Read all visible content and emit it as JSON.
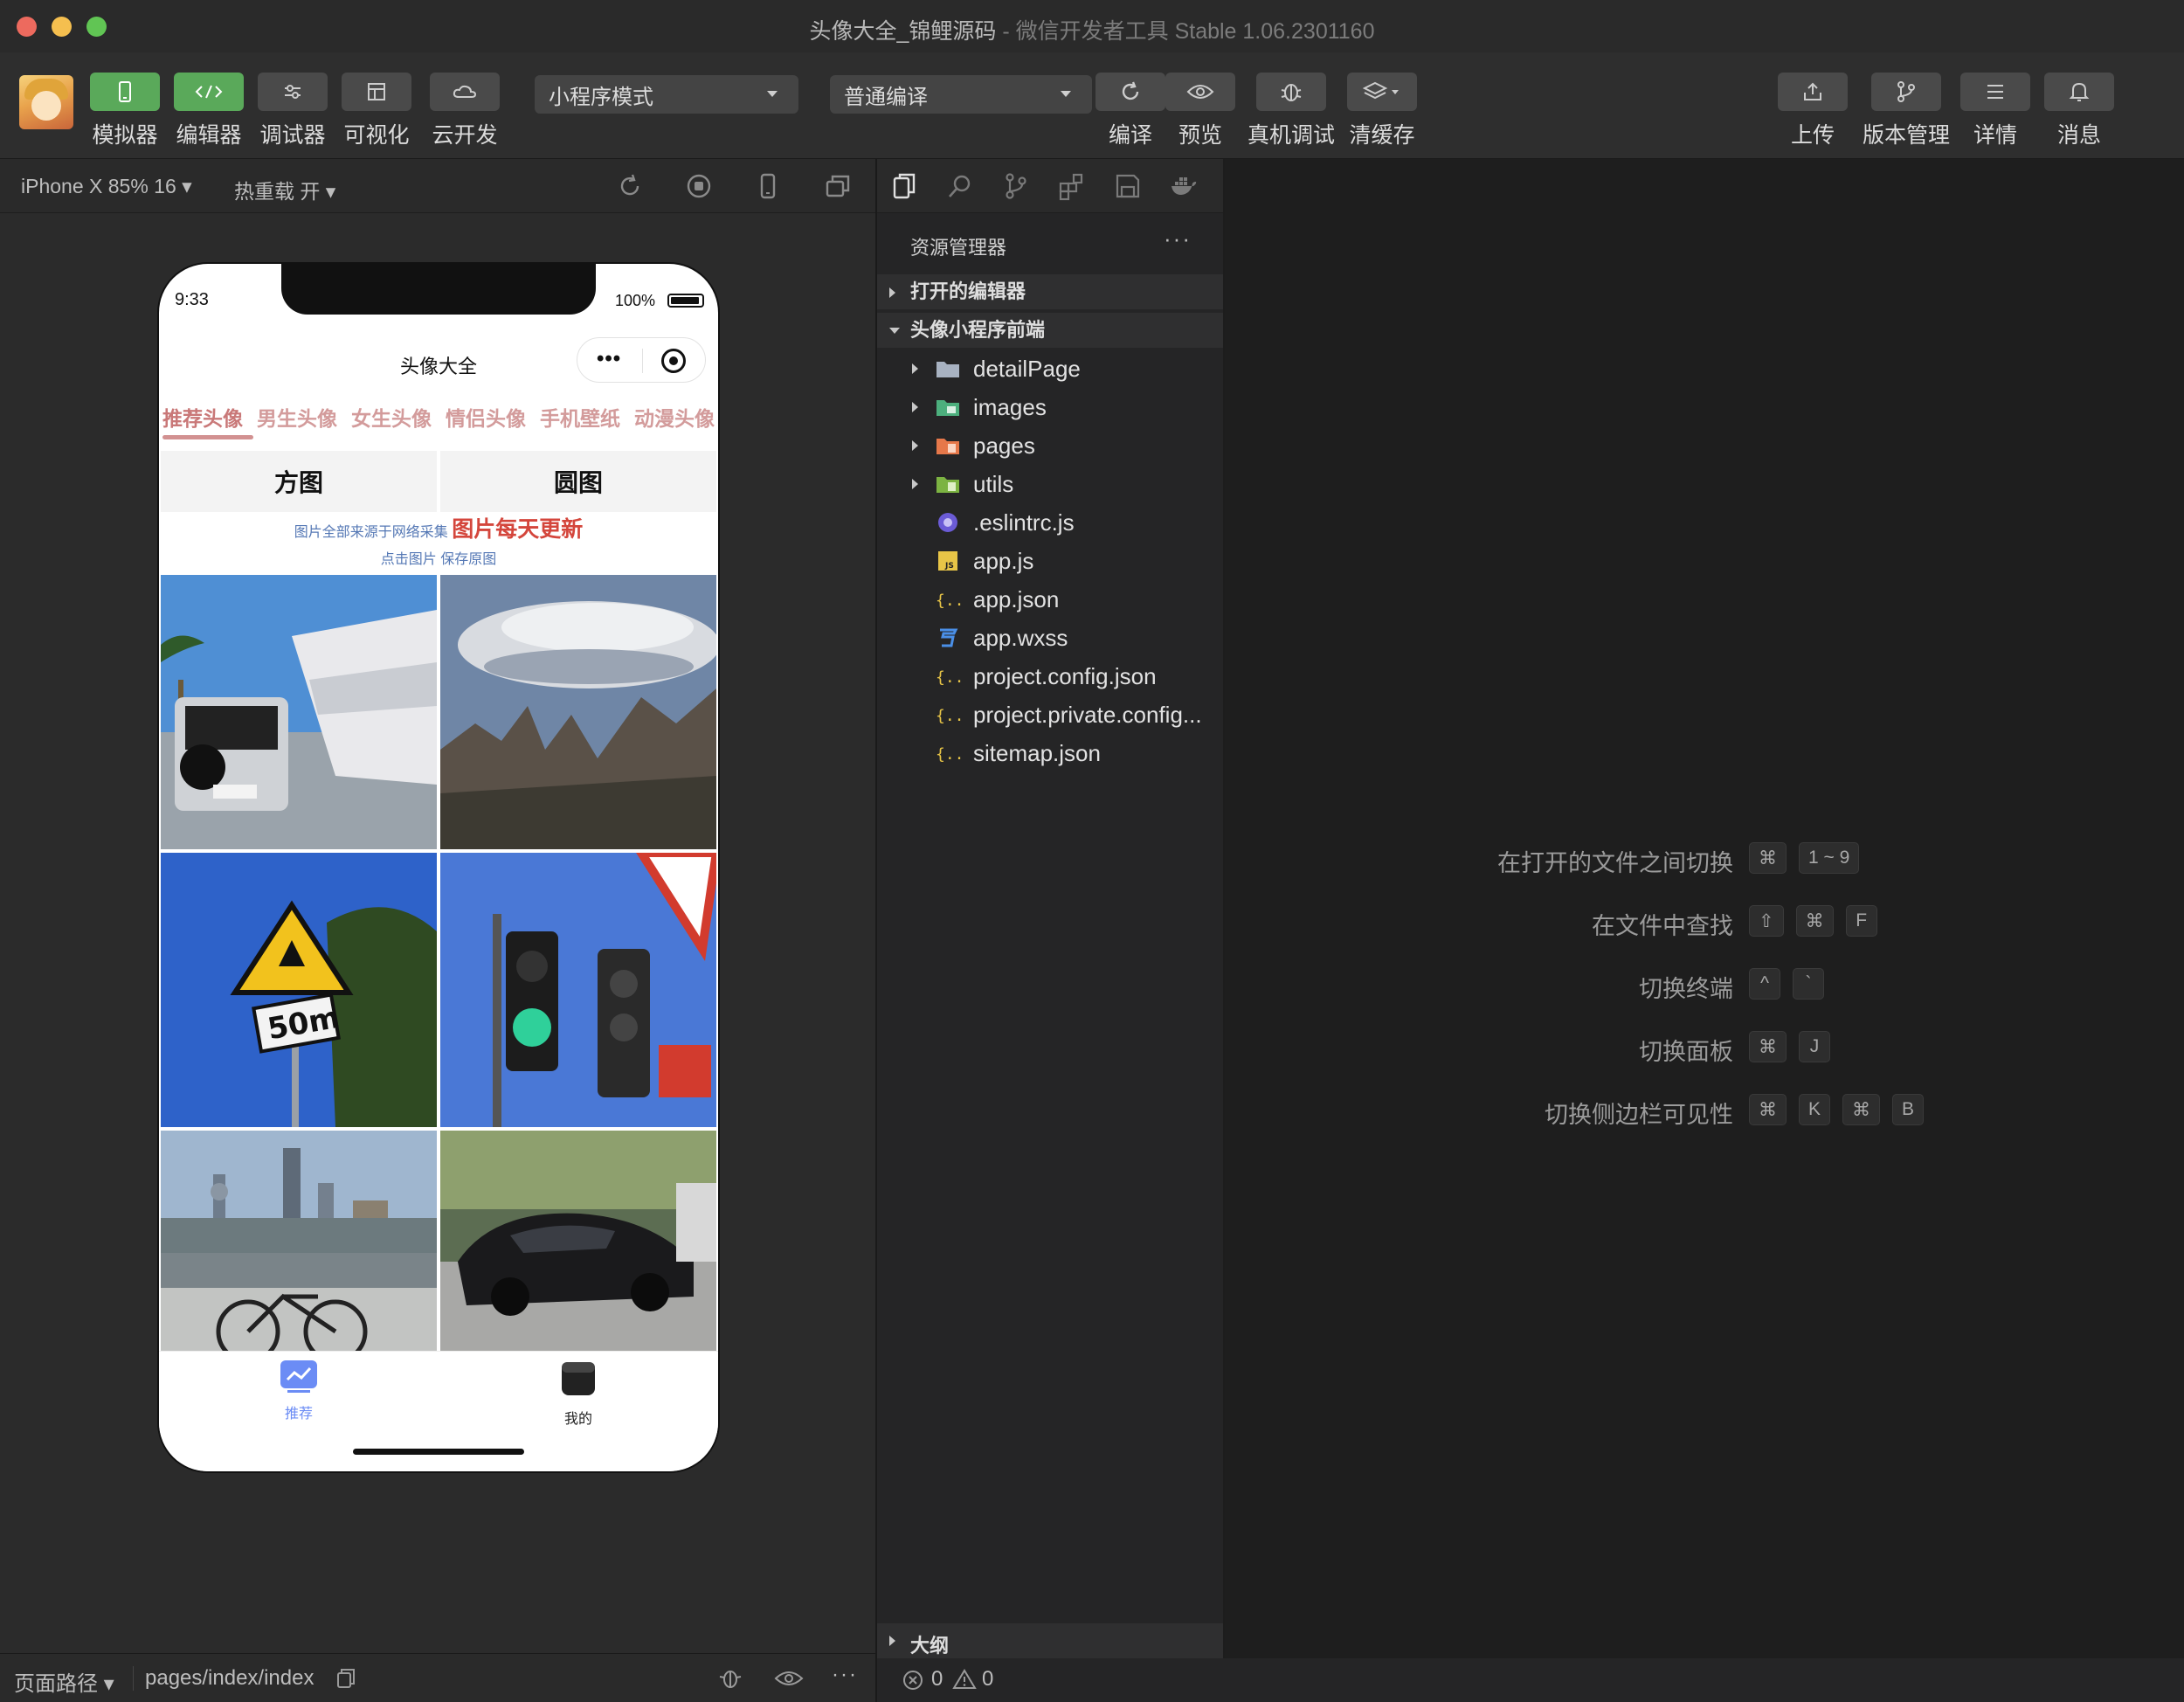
{
  "window": {
    "title_main": "头像大全_锦鲤源码",
    "title_sep": " - ",
    "title_app": "微信开发者工具 Stable 1.06.2301160"
  },
  "toolbar": {
    "left_buttons": [
      {
        "label": "模拟器",
        "icon": "phone-icon"
      },
      {
        "label": "编辑器",
        "icon": "code-icon"
      },
      {
        "label": "调试器",
        "icon": "sliders-icon"
      },
      {
        "label": "可视化",
        "icon": "layout-icon"
      },
      {
        "label": "云开发",
        "icon": "cloud-icon"
      }
    ],
    "mode_select": "小程序模式",
    "compile_select": "普通编译",
    "mid_buttons": [
      {
        "label": "编译",
        "icon": "refresh-icon"
      },
      {
        "label": "预览",
        "icon": "eye-icon"
      },
      {
        "label": "真机调试",
        "icon": "bug-icon"
      },
      {
        "label": "清缓存",
        "icon": "layers-icon"
      }
    ],
    "right_buttons": [
      {
        "label": "上传",
        "icon": "upload-icon"
      },
      {
        "label": "版本管理",
        "icon": "branch-icon"
      },
      {
        "label": "详情",
        "icon": "menu-icon"
      },
      {
        "label": "消息",
        "icon": "bell-icon"
      }
    ]
  },
  "simulator": {
    "device": "iPhone X 85% 16",
    "hotreload": "热重载 开"
  },
  "phone": {
    "time": "9:33",
    "battery": "100%",
    "nav_title": "头像大全",
    "capsule_dots": "•••",
    "categories": [
      "推荐头像",
      "男生头像",
      "女生头像",
      "情侣头像",
      "手机壁纸",
      "动漫头像"
    ],
    "segments": [
      "方图",
      "圆图"
    ],
    "notice_small": "图片全部来源于网络采集",
    "notice_big": "图片每天更新",
    "notice_tip": "点击图片 保存原图",
    "tabs": [
      {
        "label": "推荐",
        "color": "#6b8cf5"
      },
      {
        "label": "我的",
        "color": "#222222"
      }
    ]
  },
  "explorer": {
    "title": "资源管理器",
    "more": "···",
    "open_editors": "打开的编辑器",
    "project": "头像小程序前端",
    "files": [
      {
        "name": "detailPage",
        "type": "folder",
        "color": "#a8b2c1"
      },
      {
        "name": "images",
        "type": "folder",
        "color": "#4caf7d"
      },
      {
        "name": "pages",
        "type": "folder",
        "color": "#e6784a"
      },
      {
        "name": "utils",
        "type": "folder",
        "color": "#7cb342"
      },
      {
        "name": ".eslintrc.js",
        "type": "eslint",
        "color": "#6b5bd6"
      },
      {
        "name": "app.js",
        "type": "js",
        "color": "#e8c547"
      },
      {
        "name": "app.json",
        "type": "json",
        "color": "#e8c547"
      },
      {
        "name": "app.wxss",
        "type": "css",
        "color": "#4a8fe7"
      },
      {
        "name": "project.config.json",
        "type": "json",
        "color": "#e8c547"
      },
      {
        "name": "project.private.config...",
        "type": "json",
        "color": "#e8c547"
      },
      {
        "name": "sitemap.json",
        "type": "json",
        "color": "#e8c547"
      }
    ],
    "outline": "大纲"
  },
  "shortcuts": [
    {
      "label": "在打开的文件之间切换",
      "keys": [
        "⌘",
        "1 ~ 9"
      ]
    },
    {
      "label": "在文件中查找",
      "keys": [
        "⇧",
        "⌘",
        "F"
      ]
    },
    {
      "label": "切换终端",
      "keys": [
        "^",
        "`"
      ]
    },
    {
      "label": "切换面板",
      "keys": [
        "⌘",
        "J"
      ]
    },
    {
      "label": "切换侧边栏可见性",
      "keys": [
        "⌘",
        "K",
        "⌘",
        "B"
      ]
    }
  ],
  "statusbar": {
    "page_path_label": "页面路径",
    "page_path": "pages/index/index",
    "errors": "0",
    "warnings": "0"
  }
}
